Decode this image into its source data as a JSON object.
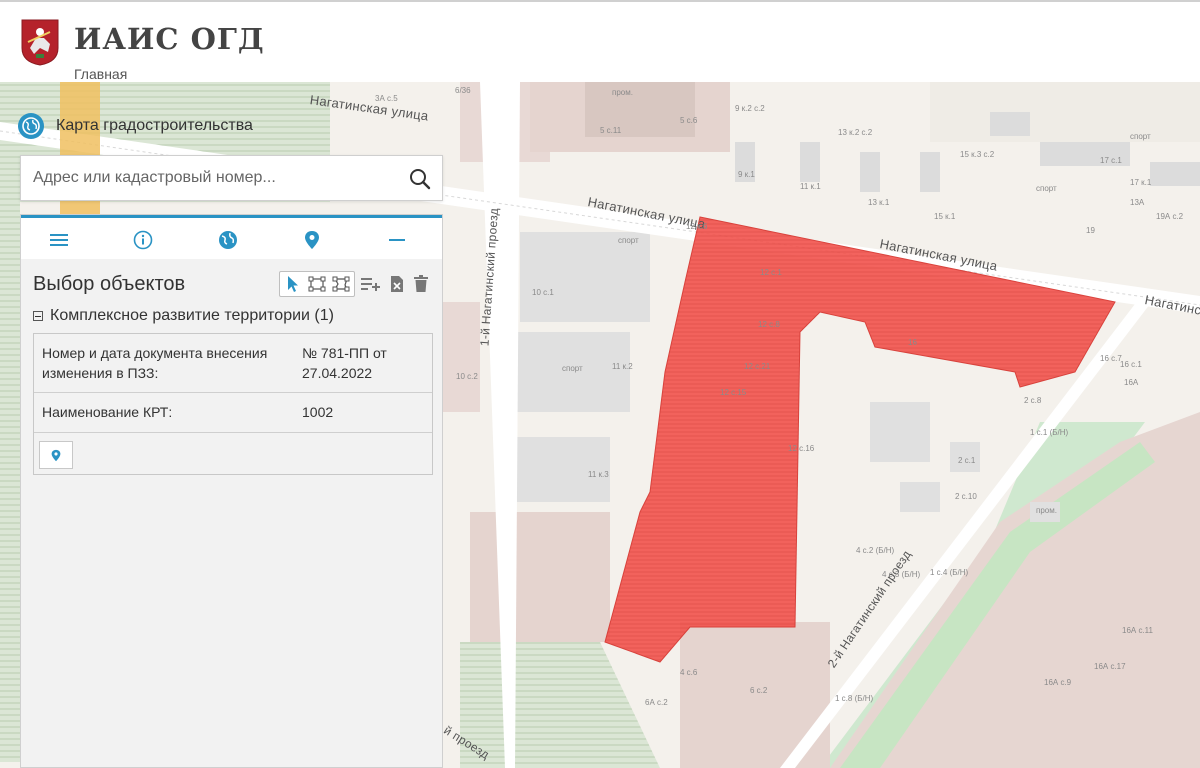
{
  "header": {
    "app_title": "ИАИС ОГД",
    "breadcrumb": "Главная"
  },
  "layer": {
    "title": "Карта градостроительства"
  },
  "search": {
    "placeholder": "Адрес или кадастровый номер..."
  },
  "toolbar": {
    "icons": [
      "menu-icon",
      "info-icon",
      "globe-icon",
      "map-pin-icon",
      "minus-icon"
    ]
  },
  "panel": {
    "title": "Выбор объектов",
    "group_label": "Комплексное развитие территории (1)",
    "rows": [
      {
        "key": "Номер и дата документа внесения изменения в ПЗЗ:",
        "value": "№ 781-ПП от 27.04.2022"
      },
      {
        "key": "Наименование КРТ:",
        "value": "1002"
      }
    ]
  },
  "map": {
    "highlight_color": "#f2534d",
    "streets": [
      "Нагатинская улица",
      "Нагатинская улица",
      "Нагатинская улица",
      "Нагатинск",
      "1-й Нагатинский проезд",
      "2-й Нагатинский проезд",
      "й проезд"
    ],
    "labels": [
      "10 с.1",
      "11 к.2",
      "11 к.3",
      "12 к.6",
      "спорт",
      "спорт",
      "спорт",
      "спорт",
      "16",
      "16 с.1",
      "16 с.7",
      "16А",
      "10 с.2",
      "5 с.11",
      "5 с.6",
      "12 с.1",
      "12 с.21",
      "12 с.15",
      "12 с.16",
      "12 с.8",
      "4 с.2 (Б/Н)",
      "4 с.3 (Б/Н)",
      "2 с.10",
      "2 с.1",
      "2 с.8",
      "1 с.1 (Б/Н)",
      "1 с.4 (Б/Н)",
      "1 с.8 (Б/Н)",
      "6 с.2",
      "4 с.6",
      "6А с.2",
      "16А с.11",
      "16А с.17",
      "16А с.9",
      "17 с.1",
      "13 к.2 с.2",
      "9 к.2 с.2",
      "15 к.3 с.2",
      "13 к.1",
      "15 к.1",
      "11 к.1",
      "9 к.1",
      "19",
      "19А с.2",
      "13А",
      "17 к.1",
      "3А с.5",
      "6/36",
      "пром.",
      "пром."
    ]
  }
}
